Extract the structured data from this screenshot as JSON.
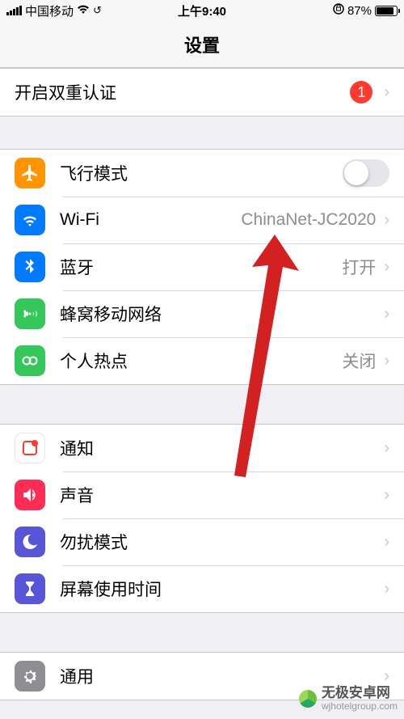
{
  "status": {
    "carrier": "中国移动",
    "time": "上午9:40",
    "battery_percent": "87%"
  },
  "header": {
    "title": "设置"
  },
  "twofa": {
    "label": "开启双重认证",
    "badge": "1"
  },
  "section_network": {
    "airplane": {
      "label": "飞行模式"
    },
    "wifi": {
      "label": "Wi-Fi",
      "value": "ChinaNet-JC2020"
    },
    "bluetooth": {
      "label": "蓝牙",
      "value": "打开"
    },
    "cellular": {
      "label": "蜂窝移动网络"
    },
    "hotspot": {
      "label": "个人热点",
      "value": "关闭"
    }
  },
  "section_app": {
    "notifications": {
      "label": "通知"
    },
    "sounds": {
      "label": "声音"
    },
    "dnd": {
      "label": "勿扰模式"
    },
    "screentime": {
      "label": "屏幕使用时间"
    }
  },
  "section_system": {
    "general": {
      "label": "通用"
    }
  },
  "watermark": {
    "main": "无极安卓网",
    "sub": "wjhotelgroup.com"
  }
}
